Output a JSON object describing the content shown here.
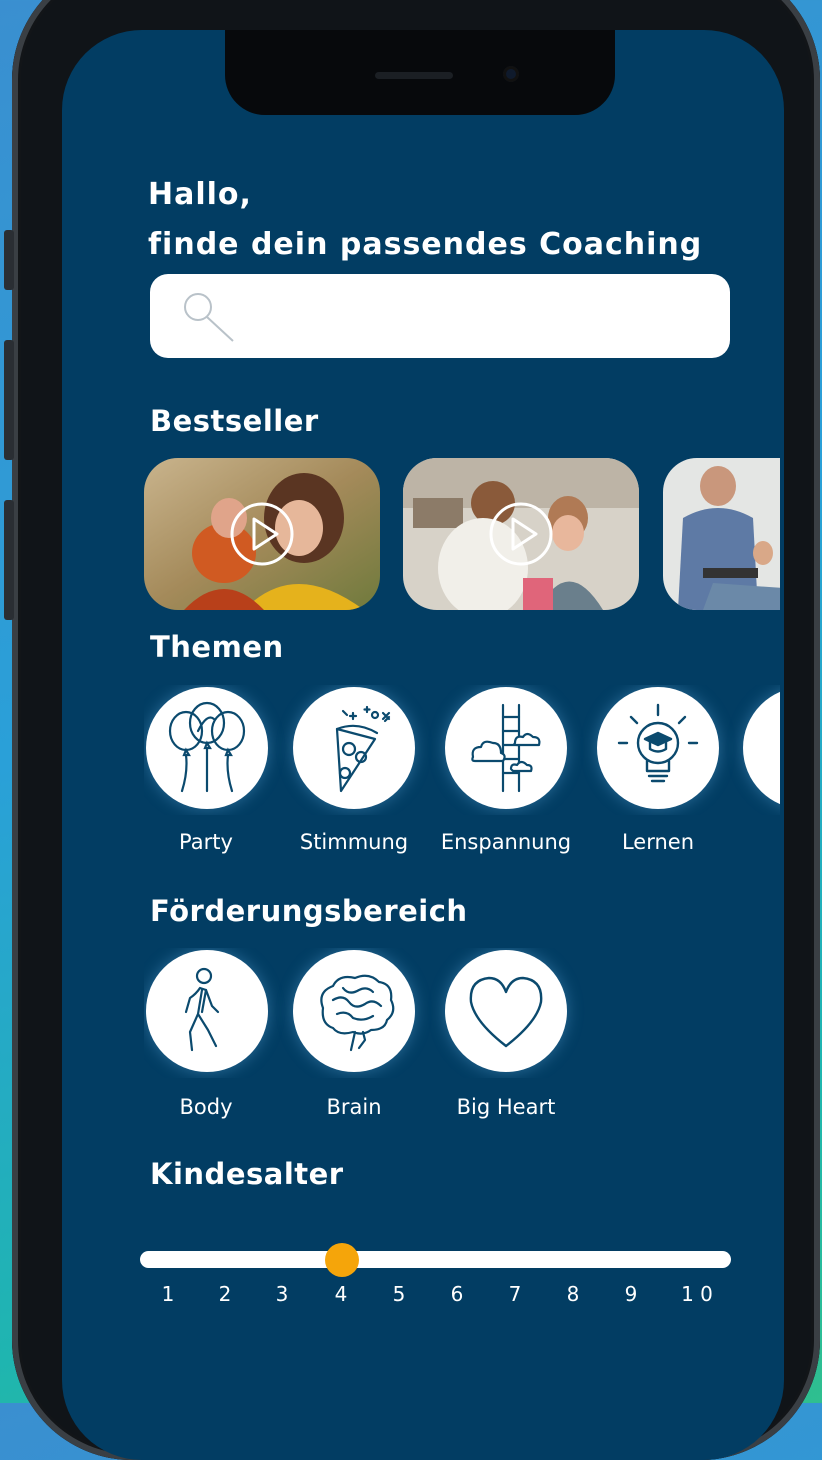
{
  "header": {
    "greeting_line1": "Hallo,",
    "greeting_line2": "finde dein passendes Coaching"
  },
  "search": {
    "icon": "search-icon",
    "placeholder": ""
  },
  "sections": {
    "bestseller": "Bestseller",
    "themen": "Themen",
    "foerderung": "Förderungsbereich",
    "kindesalter": "Kindesalter"
  },
  "bestseller": [
    {
      "image": "mother-and-child-photo",
      "icon": "play-icon"
    },
    {
      "image": "kids-in-kitchen-photo",
      "icon": "play-icon"
    },
    {
      "image": "man-with-tablet-photo"
    }
  ],
  "themen": [
    {
      "label": "Party",
      "icon": "balloons-icon"
    },
    {
      "label": "Stimmung",
      "icon": "pizza-slice-icon"
    },
    {
      "label": "Enspannung",
      "icon": "ladder-clouds-icon"
    },
    {
      "label": "Lernen",
      "icon": "lightbulb-graduation-icon"
    }
  ],
  "foerderung": [
    {
      "label": "Body",
      "icon": "walking-person-icon"
    },
    {
      "label": "Brain",
      "icon": "brain-icon"
    },
    {
      "label": "Big Heart",
      "icon": "heart-icon"
    }
  ],
  "age_slider": {
    "ticks": [
      "1",
      "2",
      "3",
      "4",
      "5",
      "6",
      "7",
      "8",
      "9",
      "1 0"
    ],
    "selected": 4
  },
  "colors": {
    "screen_bg": "#023d63",
    "icon_stroke": "#0b4a6e",
    "slider_thumb": "#f5a50a"
  }
}
